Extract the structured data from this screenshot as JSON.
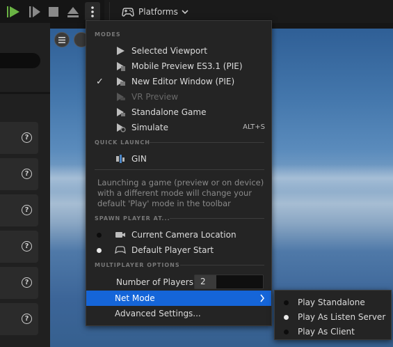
{
  "toolbar": {
    "platforms_label": "Platforms"
  },
  "menu": {
    "sections": {
      "modes": "MODES",
      "quick_launch": "QUICK LAUNCH",
      "spawn_player": "SPAWN PLAYER AT...",
      "multiplayer": "MULTIPLAYER OPTIONS"
    },
    "modes": [
      {
        "label": "Selected Viewport",
        "icon": "play-icon",
        "checked": false,
        "disabled": false,
        "shortcut": ""
      },
      {
        "label": "Mobile Preview ES3.1 (PIE)",
        "icon": "mobile-preview-icon",
        "checked": false,
        "disabled": false,
        "shortcut": ""
      },
      {
        "label": "New Editor Window (PIE)",
        "icon": "new-window-icon",
        "checked": true,
        "disabled": false,
        "shortcut": ""
      },
      {
        "label": "VR Preview",
        "icon": "vr-icon",
        "checked": false,
        "disabled": true,
        "shortcut": ""
      },
      {
        "label": "Standalone Game",
        "icon": "standalone-icon",
        "checked": false,
        "disabled": false,
        "shortcut": ""
      },
      {
        "label": "Simulate",
        "icon": "simulate-icon",
        "checked": false,
        "disabled": false,
        "shortcut": "ALT+S"
      }
    ],
    "check_glyph": "✓",
    "quick_launch_item": "GIN",
    "hint": "Launching a game (preview or on device) with a different mode will change your default 'Play' mode in the toolbar",
    "spawn": [
      {
        "label": "Current Camera Location",
        "selected": false
      },
      {
        "label": "Default Player Start",
        "selected": true
      }
    ],
    "number_of_players_label": "Number of Players",
    "number_of_players_value": "2",
    "net_mode_label": "Net Mode",
    "advanced_settings_label": "Advanced Settings..."
  },
  "net_mode_submenu": [
    {
      "label": "Play Standalone",
      "selected": false
    },
    {
      "label": "Play As Listen Server",
      "selected": true
    },
    {
      "label": "Play As Client",
      "selected": false
    }
  ],
  "colors": {
    "accent": "#1565d8",
    "play_green": "#6ab344"
  }
}
